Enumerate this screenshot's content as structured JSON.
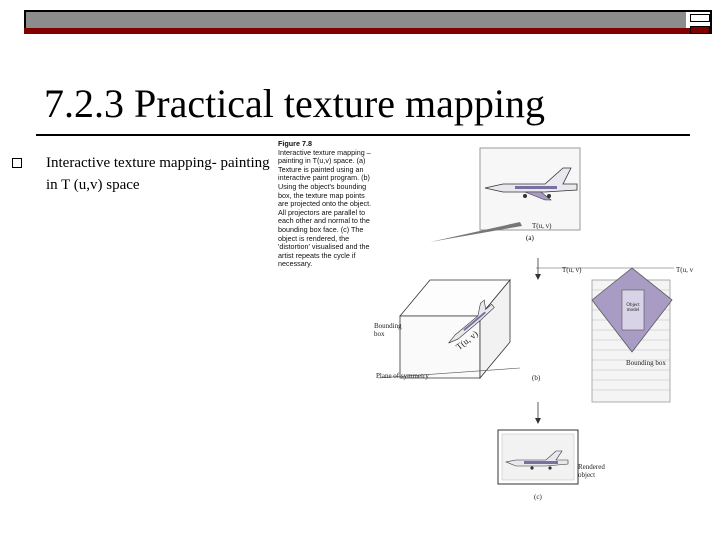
{
  "slide": {
    "title": "7.2.3 Practical texture mapping",
    "bullet_text": "Interactive texture mapping- painting in T (u,v) space"
  },
  "figure": {
    "heading": "Figure 7.8",
    "caption": "Interactive texture mapping – painting in T(u,v) space. (a) Texture is painted using an interactive paint program. (b) Using the object's bounding box, the texture map points are projected onto the object. All projectors are parallel to each other and normal to the bounding box face. (c) The object is rendered, the 'distortion' visualised and the artist repeats the cycle if necessary.",
    "label_tuv_a": "T(u, v)",
    "label_a": "(a)",
    "label_tuv_left": "T(u, v)",
    "label_tuv_right": "T(u, v",
    "label_bounding_box_left": "Bounding box",
    "label_plane": "Plane of symmetry",
    "label_tuv_rot": "T(u, v)",
    "label_object_model": "Object model",
    "label_bounding_box_right": "Bounding box",
    "label_b": "(b)",
    "label_rendered": "Rendered object",
    "label_c": "(c)"
  },
  "colors": {
    "bar_gray": "#8c8c8c",
    "bar_red": "#800000",
    "plane_fill": "#a99cc4"
  }
}
